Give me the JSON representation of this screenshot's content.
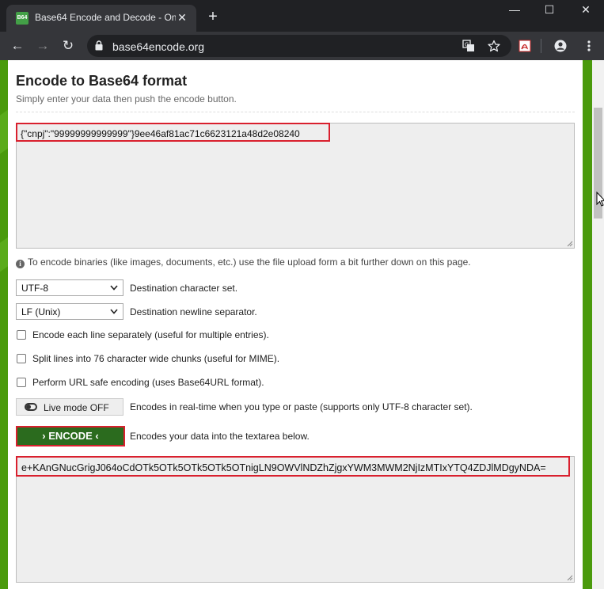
{
  "browser": {
    "tab_title": "Base64 Encode and Decode - Onl",
    "favicon_text": "B64",
    "tab_close": "✕",
    "new_tab": "+",
    "window": {
      "minimize": "—",
      "maximize": "☐",
      "close": "✕"
    },
    "nav": {
      "back": "←",
      "forward": "→",
      "reload": "↻"
    },
    "url": "base64encode.org",
    "icons": [
      "lock-icon",
      "translate-icon",
      "star-icon",
      "pdf-extension-icon",
      "profile-icon",
      "menu-icon"
    ]
  },
  "page": {
    "heading": "Encode to Base64 format",
    "subtitle": "Simply enter your data then push the encode button.",
    "input_value": "{\"cnpj\":\"99999999999999\"}9ee46af81ac71c6623121a48d2e08240",
    "info_text": "To encode binaries (like images, documents, etc.) use the file upload form a bit further down on this page.",
    "charset": {
      "value": "UTF-8",
      "label": "Destination character set."
    },
    "newline": {
      "value": "LF (Unix)",
      "label": "Destination newline separator."
    },
    "options": [
      "Encode each line separately (useful for multiple entries).",
      "Split lines into 76 character wide chunks (useful for MIME).",
      "Perform URL safe encoding (uses Base64URL format)."
    ],
    "live_mode": {
      "button": "Live mode OFF",
      "label": "Encodes in real-time when you type or paste (supports only UTF-8 character set)."
    },
    "encode": {
      "button": "› ENCODE ‹",
      "label": "Encodes your data into the textarea below."
    },
    "output_value": "e+KAnGNucGrigJ064oCdOTk5OTk5OTk5OTk5OTnigLN9OWVlNDZhZjgxYWM3MWM2NjIzMTIxYTQ4ZDJlMDgyNDA="
  },
  "colors": {
    "accent_green": "#2b6b1e",
    "highlight_red": "#d9202e",
    "page_green": "#4a9a0c"
  }
}
